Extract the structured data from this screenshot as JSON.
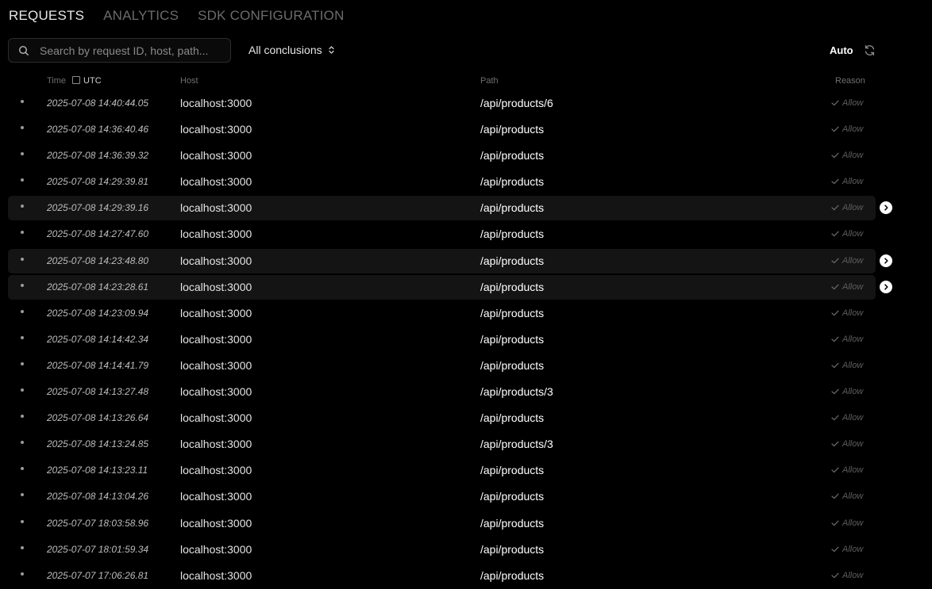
{
  "tabs": [
    {
      "label": "REQUESTS",
      "active": true
    },
    {
      "label": "ANALYTICS",
      "active": false
    },
    {
      "label": "SDK CONFIGURATION",
      "active": false
    }
  ],
  "search": {
    "placeholder": "Search by request ID, host, path..."
  },
  "filter": {
    "label": "All conclusions"
  },
  "refresh": {
    "auto_label": "Auto"
  },
  "columns": {
    "time": "Time",
    "utc": "UTC",
    "host": "Host",
    "path": "Path",
    "reason": "Reason"
  },
  "rows": [
    {
      "time": "2025-07-08 14:40:44.05",
      "host": "localhost:3000",
      "path": "/api/products/6",
      "reason": "Allow",
      "highlighted": false
    },
    {
      "time": "2025-07-08 14:36:40.46",
      "host": "localhost:3000",
      "path": "/api/products",
      "reason": "Allow",
      "highlighted": false
    },
    {
      "time": "2025-07-08 14:36:39.32",
      "host": "localhost:3000",
      "path": "/api/products",
      "reason": "Allow",
      "highlighted": false
    },
    {
      "time": "2025-07-08 14:29:39.81",
      "host": "localhost:3000",
      "path": "/api/products",
      "reason": "Allow",
      "highlighted": false
    },
    {
      "time": "2025-07-08 14:29:39.16",
      "host": "localhost:3000",
      "path": "/api/products",
      "reason": "Allow",
      "highlighted": true
    },
    {
      "time": "2025-07-08 14:27:47.60",
      "host": "localhost:3000",
      "path": "/api/products",
      "reason": "Allow",
      "highlighted": false
    },
    {
      "time": "2025-07-08 14:23:48.80",
      "host": "localhost:3000",
      "path": "/api/products",
      "reason": "Allow",
      "highlighted": true
    },
    {
      "time": "2025-07-08 14:23:28.61",
      "host": "localhost:3000",
      "path": "/api/products",
      "reason": "Allow",
      "highlighted": true
    },
    {
      "time": "2025-07-08 14:23:09.94",
      "host": "localhost:3000",
      "path": "/api/products",
      "reason": "Allow",
      "highlighted": false
    },
    {
      "time": "2025-07-08 14:14:42.34",
      "host": "localhost:3000",
      "path": "/api/products",
      "reason": "Allow",
      "highlighted": false
    },
    {
      "time": "2025-07-08 14:14:41.79",
      "host": "localhost:3000",
      "path": "/api/products",
      "reason": "Allow",
      "highlighted": false
    },
    {
      "time": "2025-07-08 14:13:27.48",
      "host": "localhost:3000",
      "path": "/api/products/3",
      "reason": "Allow",
      "highlighted": false
    },
    {
      "time": "2025-07-08 14:13:26.64",
      "host": "localhost:3000",
      "path": "/api/products",
      "reason": "Allow",
      "highlighted": false
    },
    {
      "time": "2025-07-08 14:13:24.85",
      "host": "localhost:3000",
      "path": "/api/products/3",
      "reason": "Allow",
      "highlighted": false
    },
    {
      "time": "2025-07-08 14:13:23.11",
      "host": "localhost:3000",
      "path": "/api/products",
      "reason": "Allow",
      "highlighted": false
    },
    {
      "time": "2025-07-08 14:13:04.26",
      "host": "localhost:3000",
      "path": "/api/products",
      "reason": "Allow",
      "highlighted": false
    },
    {
      "time": "2025-07-07 18:03:58.96",
      "host": "localhost:3000",
      "path": "/api/products",
      "reason": "Allow",
      "highlighted": false
    },
    {
      "time": "2025-07-07 18:01:59.34",
      "host": "localhost:3000",
      "path": "/api/products",
      "reason": "Allow",
      "highlighted": false
    },
    {
      "time": "2025-07-07 17:06:26.81",
      "host": "localhost:3000",
      "path": "/api/products",
      "reason": "Allow",
      "highlighted": false
    }
  ]
}
